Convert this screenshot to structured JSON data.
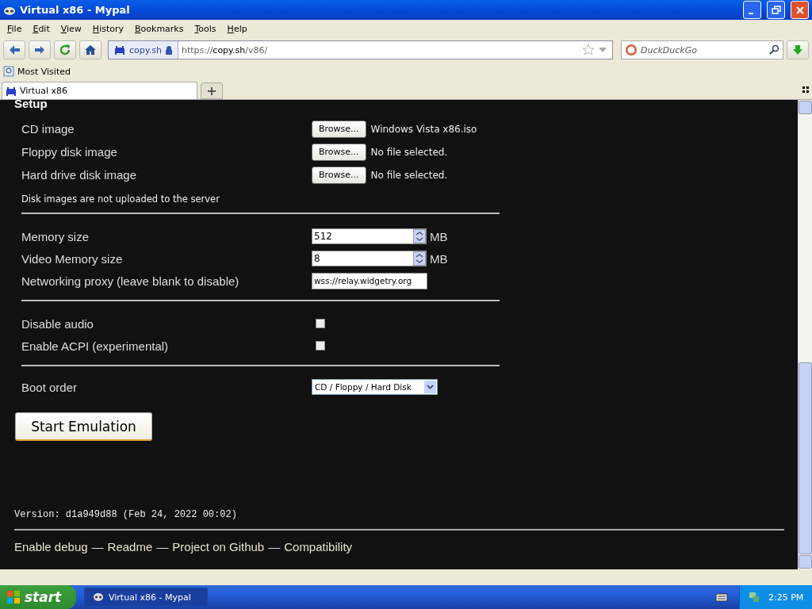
{
  "window": {
    "title": "Virtual x86 - Mypal"
  },
  "menu": [
    "File",
    "Edit",
    "View",
    "History",
    "Bookmarks",
    "Tools",
    "Help"
  ],
  "navbar": {
    "site_identity": "copy.sh",
    "url_scheme": "https://",
    "url_host": "copy.sh",
    "url_path": "/v86/",
    "search_placeholder": "DuckDuckGo"
  },
  "bookmarks": [
    {
      "label": "Most Visited"
    }
  ],
  "tabs": [
    {
      "label": "Virtual x86",
      "selected": true
    }
  ],
  "page": {
    "heading": "Setup",
    "files": [
      {
        "label": "CD image",
        "button": "Browse...",
        "status": "Windows Vista x86.iso"
      },
      {
        "label": "Floppy disk image",
        "button": "Browse...",
        "status": "No file selected."
      },
      {
        "label": "Hard drive disk image",
        "button": "Browse...",
        "status": "No file selected."
      }
    ],
    "note": "Disk images are not uploaded to the server",
    "numbers": [
      {
        "label": "Memory size",
        "value": "512",
        "unit": "MB"
      },
      {
        "label": "Video Memory size",
        "value": "8",
        "unit": "MB"
      }
    ],
    "proxy": {
      "label": "Networking proxy (leave blank to disable)",
      "value": "wss://relay.widgetry.org"
    },
    "options": [
      {
        "label": "Disable audio",
        "checked": false
      },
      {
        "label": "Enable ACPI (experimental)",
        "checked": false
      }
    ],
    "boot_order": {
      "label": "Boot order",
      "value": "CD / Floppy / Hard Disk"
    },
    "start_button": "Start Emulation",
    "version": "Version: d1a949d88 (Feb 24, 2022 00:02)",
    "footer_links": [
      "Enable debug",
      "Readme",
      "Project on Github",
      "Compatibility"
    ],
    "footer_separator": "—"
  },
  "taskbar": {
    "start": "start",
    "tasks": [
      {
        "label": "Virtual x86 - Mypal",
        "selected": true
      }
    ],
    "clock": "2:25 PM"
  }
}
